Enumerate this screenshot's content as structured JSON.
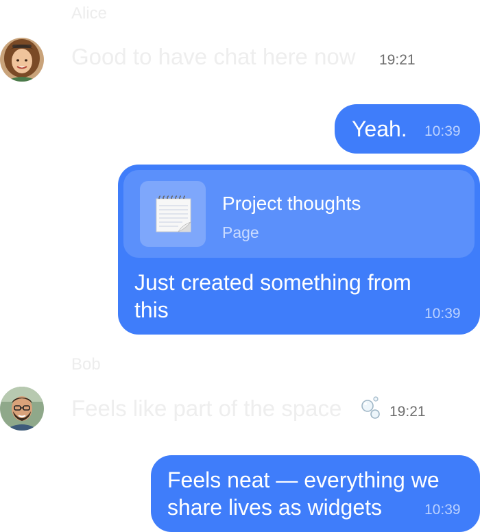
{
  "messages": [
    {
      "sender": "Alice",
      "text": "Good to have chat here now",
      "time": "19:21"
    },
    {
      "text": "Yeah.",
      "time": "10:39"
    },
    {
      "attachment": {
        "title": "Project thoughts",
        "subtitle": "Page",
        "icon": "notepad-icon"
      },
      "text_line1": "Just created something from",
      "text_line2": "this",
      "time": "10:39"
    },
    {
      "sender": "Bob",
      "text": "Feels like part of the space",
      "time": "19:21",
      "reaction_icon": "bubbles-icon"
    },
    {
      "text_line1": "Feels neat — everything we",
      "text_line2": "share lives as widgets",
      "time": "10:39"
    }
  ],
  "colors": {
    "bubble": "#3f7dfa",
    "attachment_card": "#5b90fb",
    "faded_text": "#eeeeee",
    "timestamp_gray": "#6d6d6d"
  }
}
